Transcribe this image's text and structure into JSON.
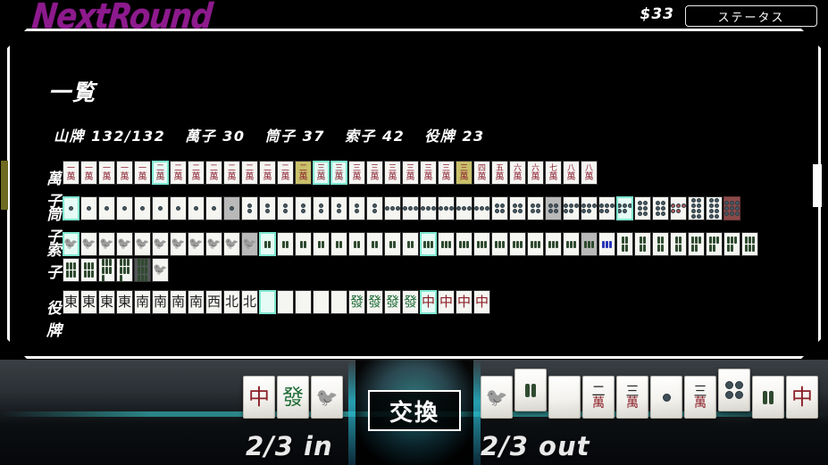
{
  "top": {
    "game_title": "NextRound",
    "money": "$33",
    "status_button": "ステータス",
    "title_color": "#8d1a8d"
  },
  "panel": {
    "title": "一覧",
    "stats": [
      {
        "label": "山牌",
        "value": "132/132"
      },
      {
        "label": "萬子",
        "value": "30"
      },
      {
        "label": "筒子",
        "value": "37"
      },
      {
        "label": "索子",
        "value": "42"
      },
      {
        "label": "役牌",
        "value": "23"
      }
    ],
    "rows": [
      {
        "label": "萬子",
        "name": "row-manzu",
        "tiles": [
          {
            "k": "man",
            "n": "一",
            "hl": ""
          },
          {
            "k": "man",
            "n": "一",
            "hl": ""
          },
          {
            "k": "man",
            "n": "一",
            "hl": ""
          },
          {
            "k": "man",
            "n": "一",
            "hl": ""
          },
          {
            "k": "man",
            "n": "一",
            "hl": ""
          },
          {
            "k": "man",
            "n": "二",
            "hl": "teal"
          },
          {
            "k": "man",
            "n": "二",
            "hl": ""
          },
          {
            "k": "man",
            "n": "二",
            "hl": ""
          },
          {
            "k": "man",
            "n": "二",
            "hl": ""
          },
          {
            "k": "man",
            "n": "二",
            "hl": ""
          },
          {
            "k": "man",
            "n": "二",
            "hl": ""
          },
          {
            "k": "man",
            "n": "二",
            "hl": ""
          },
          {
            "k": "man",
            "n": "二",
            "hl": ""
          },
          {
            "k": "man",
            "n": "二",
            "hl": "yellow"
          },
          {
            "k": "man",
            "n": "三",
            "hl": "teal"
          },
          {
            "k": "man",
            "n": "三",
            "hl": "teal"
          },
          {
            "k": "man",
            "n": "三",
            "hl": ""
          },
          {
            "k": "man",
            "n": "三",
            "hl": ""
          },
          {
            "k": "man",
            "n": "三",
            "hl": ""
          },
          {
            "k": "man",
            "n": "三",
            "hl": ""
          },
          {
            "k": "man",
            "n": "三",
            "hl": ""
          },
          {
            "k": "man",
            "n": "三",
            "hl": ""
          },
          {
            "k": "man",
            "n": "三",
            "hl": "yellow"
          },
          {
            "k": "man",
            "n": "四",
            "hl": ""
          },
          {
            "k": "man",
            "n": "五",
            "hl": ""
          },
          {
            "k": "man",
            "n": "六",
            "hl": ""
          },
          {
            "k": "man",
            "n": "六",
            "hl": ""
          },
          {
            "k": "man",
            "n": "七",
            "hl": ""
          },
          {
            "k": "man",
            "n": "八",
            "hl": ""
          },
          {
            "k": "man",
            "n": "八",
            "hl": ""
          }
        ]
      },
      {
        "label": "筒子",
        "name": "row-pinzu",
        "tiles": [
          {
            "k": "pin",
            "n": 1,
            "hl": "teal"
          },
          {
            "k": "pin",
            "n": 1,
            "hl": ""
          },
          {
            "k": "pin",
            "n": 1,
            "hl": ""
          },
          {
            "k": "pin",
            "n": 1,
            "hl": ""
          },
          {
            "k": "pin",
            "n": 1,
            "hl": ""
          },
          {
            "k": "pin",
            "n": 1,
            "hl": ""
          },
          {
            "k": "pin",
            "n": 1,
            "hl": ""
          },
          {
            "k": "pin",
            "n": 1,
            "hl": ""
          },
          {
            "k": "pin",
            "n": 1,
            "hl": ""
          },
          {
            "k": "pin",
            "n": 1,
            "hl": "grey"
          },
          {
            "k": "pin",
            "n": 2,
            "hl": ""
          },
          {
            "k": "pin",
            "n": 2,
            "hl": ""
          },
          {
            "k": "pin",
            "n": 2,
            "hl": ""
          },
          {
            "k": "pin",
            "n": 2,
            "hl": ""
          },
          {
            "k": "pin",
            "n": 2,
            "hl": ""
          },
          {
            "k": "pin",
            "n": 2,
            "hl": ""
          },
          {
            "k": "pin",
            "n": 2,
            "hl": ""
          },
          {
            "k": "pin",
            "n": 2,
            "hl": ""
          },
          {
            "k": "pin",
            "n": 3,
            "hl": ""
          },
          {
            "k": "pin",
            "n": 3,
            "hl": ""
          },
          {
            "k": "pin",
            "n": 3,
            "hl": ""
          },
          {
            "k": "pin",
            "n": 3,
            "hl": ""
          },
          {
            "k": "pin",
            "n": 3,
            "hl": ""
          },
          {
            "k": "pin",
            "n": 3,
            "hl": ""
          },
          {
            "k": "pin",
            "n": 4,
            "hl": ""
          },
          {
            "k": "pin",
            "n": 4,
            "hl": ""
          },
          {
            "k": "pin",
            "n": 4,
            "hl": ""
          },
          {
            "k": "pin",
            "n": 4,
            "hl": "grey"
          },
          {
            "k": "pin",
            "n": 5,
            "hl": ""
          },
          {
            "k": "pin",
            "n": 5,
            "hl": ""
          },
          {
            "k": "pin",
            "n": 5,
            "hl": ""
          },
          {
            "k": "pin",
            "n": 5,
            "hl": "teal"
          },
          {
            "k": "pin",
            "n": 6,
            "hl": ""
          },
          {
            "k": "pin",
            "n": 6,
            "hl": ""
          },
          {
            "k": "pin",
            "n": 5,
            "hl": "dora"
          },
          {
            "k": "pin",
            "n": 8,
            "hl": ""
          },
          {
            "k": "pin",
            "n": 8,
            "hl": ""
          },
          {
            "k": "pin",
            "n": 9,
            "hl": "red"
          }
        ]
      },
      {
        "label": "索子",
        "name": "row-souzu",
        "tiles": [
          {
            "k": "sou",
            "n": 1,
            "hl": "teal"
          },
          {
            "k": "sou",
            "n": 1,
            "hl": ""
          },
          {
            "k": "sou",
            "n": 1,
            "hl": ""
          },
          {
            "k": "sou",
            "n": 1,
            "hl": ""
          },
          {
            "k": "sou",
            "n": 1,
            "hl": ""
          },
          {
            "k": "sou",
            "n": 1,
            "hl": ""
          },
          {
            "k": "sou",
            "n": 1,
            "hl": ""
          },
          {
            "k": "sou",
            "n": 1,
            "hl": ""
          },
          {
            "k": "sou",
            "n": 1,
            "hl": ""
          },
          {
            "k": "sou",
            "n": 1,
            "hl": ""
          },
          {
            "k": "sou",
            "n": 1,
            "hl": "grey"
          },
          {
            "k": "sou",
            "n": 2,
            "hl": "teal"
          },
          {
            "k": "sou",
            "n": 2,
            "hl": ""
          },
          {
            "k": "sou",
            "n": 2,
            "hl": ""
          },
          {
            "k": "sou",
            "n": 2,
            "hl": ""
          },
          {
            "k": "sou",
            "n": 2,
            "hl": ""
          },
          {
            "k": "sou",
            "n": 2,
            "hl": ""
          },
          {
            "k": "sou",
            "n": 2,
            "hl": ""
          },
          {
            "k": "sou",
            "n": 2,
            "hl": ""
          },
          {
            "k": "sou",
            "n": 2,
            "hl": ""
          },
          {
            "k": "sou",
            "n": 3,
            "hl": "teal"
          },
          {
            "k": "sou",
            "n": 3,
            "hl": ""
          },
          {
            "k": "sou",
            "n": 3,
            "hl": ""
          },
          {
            "k": "sou",
            "n": 3,
            "hl": ""
          },
          {
            "k": "sou",
            "n": 3,
            "hl": ""
          },
          {
            "k": "sou",
            "n": 3,
            "hl": ""
          },
          {
            "k": "sou",
            "n": 3,
            "hl": ""
          },
          {
            "k": "sou",
            "n": 3,
            "hl": ""
          },
          {
            "k": "sou",
            "n": 3,
            "hl": ""
          },
          {
            "k": "sou",
            "n": 3,
            "hl": "grey"
          },
          {
            "k": "sou",
            "n": 3,
            "hl": "blue"
          },
          {
            "k": "sou",
            "n": 4,
            "hl": ""
          },
          {
            "k": "sou",
            "n": 4,
            "hl": ""
          },
          {
            "k": "sou",
            "n": 4,
            "hl": ""
          },
          {
            "k": "sou",
            "n": 4,
            "hl": ""
          },
          {
            "k": "sou",
            "n": 5,
            "hl": ""
          },
          {
            "k": "sou",
            "n": 5,
            "hl": ""
          },
          {
            "k": "sou",
            "n": 5,
            "hl": ""
          },
          {
            "k": "sou",
            "n": 6,
            "hl": ""
          },
          {
            "k": "sou",
            "n": 6,
            "hl": ""
          },
          {
            "k": "sou",
            "n": 6,
            "hl": ""
          },
          {
            "k": "sou",
            "n": 7,
            "hl": ""
          },
          {
            "k": "sou",
            "n": 7,
            "hl": ""
          },
          {
            "k": "sou",
            "n": 9,
            "hl": "dark"
          },
          {
            "k": "sou",
            "n": 1,
            "hl": "wrap"
          }
        ]
      },
      {
        "label": "役牌",
        "name": "row-honors",
        "tiles": [
          {
            "k": "honor",
            "n": "東",
            "hl": ""
          },
          {
            "k": "honor",
            "n": "東",
            "hl": ""
          },
          {
            "k": "honor",
            "n": "東",
            "hl": ""
          },
          {
            "k": "honor",
            "n": "東",
            "hl": ""
          },
          {
            "k": "honor",
            "n": "南",
            "hl": ""
          },
          {
            "k": "honor",
            "n": "南",
            "hl": ""
          },
          {
            "k": "honor",
            "n": "南",
            "hl": ""
          },
          {
            "k": "honor",
            "n": "南",
            "hl": ""
          },
          {
            "k": "honor",
            "n": "西",
            "hl": ""
          },
          {
            "k": "honor",
            "n": "北",
            "hl": ""
          },
          {
            "k": "honor",
            "n": "北",
            "hl": ""
          },
          {
            "k": "honor",
            "n": "白",
            "hl": "teal"
          },
          {
            "k": "honor",
            "n": "白",
            "hl": ""
          },
          {
            "k": "honor",
            "n": "白",
            "hl": ""
          },
          {
            "k": "honor",
            "n": "白",
            "hl": ""
          },
          {
            "k": "honor",
            "n": "白",
            "hl": ""
          },
          {
            "k": "hatsu",
            "n": "發",
            "hl": ""
          },
          {
            "k": "hatsu",
            "n": "發",
            "hl": ""
          },
          {
            "k": "hatsu",
            "n": "發",
            "hl": ""
          },
          {
            "k": "hatsu",
            "n": "發",
            "hl": ""
          },
          {
            "k": "chun",
            "n": "中",
            "hl": "teal"
          },
          {
            "k": "chun",
            "n": "中",
            "hl": ""
          },
          {
            "k": "chun",
            "n": "中",
            "hl": ""
          },
          {
            "k": "chun",
            "n": "中",
            "hl": ""
          }
        ]
      }
    ]
  },
  "bottom": {
    "in_counter": "2/3 in",
    "out_counter": "2/3 out",
    "exchange_label": "交換",
    "in_tiles": [
      {
        "k": "chun",
        "n": "中"
      },
      {
        "k": "hatsu",
        "n": "發"
      },
      {
        "k": "sou",
        "n": 1
      }
    ],
    "out_tiles": [
      {
        "k": "sou",
        "n": 1
      },
      {
        "k": "sou",
        "n": 2,
        "raised": true
      },
      {
        "k": "blank",
        "n": ""
      },
      {
        "k": "man",
        "n": "二"
      },
      {
        "k": "man",
        "n": "三"
      },
      {
        "k": "pin",
        "n": 1
      },
      {
        "k": "man",
        "n": "三"
      },
      {
        "k": "pin",
        "n": 4,
        "raised": true
      },
      {
        "k": "sou",
        "n": 2
      },
      {
        "k": "chun",
        "n": "中"
      }
    ]
  }
}
